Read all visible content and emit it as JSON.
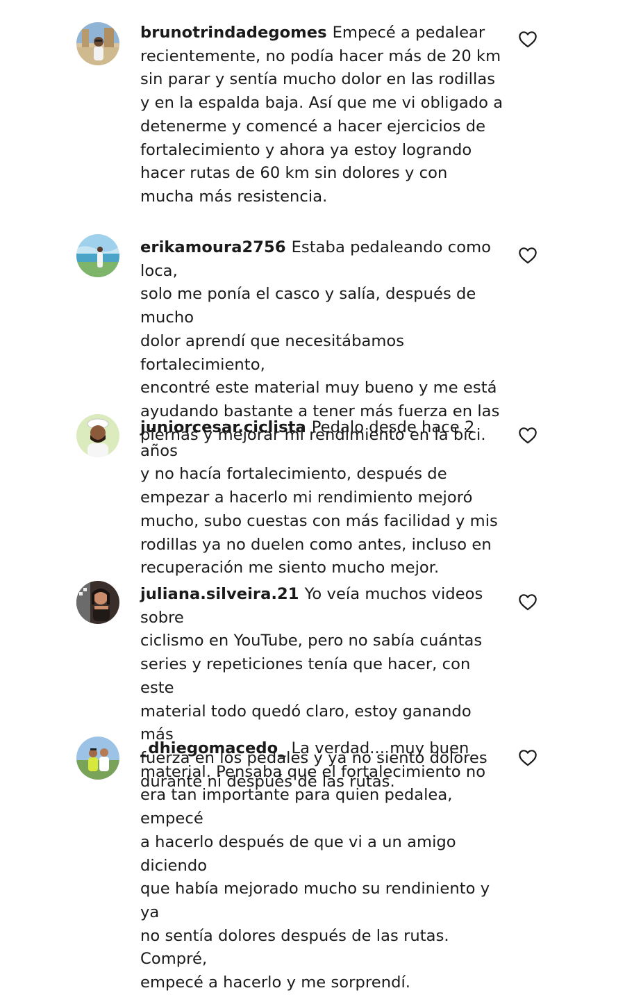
{
  "comments": [
    {
      "username": "brunotrindadegomes",
      "text": "Empecé a pedalear\nrecientemente, no podía hacer más de 20 km\nsin parar y sentía mucho dolor en las rodillas\ny en la espalda baja. Así que me vi obligado a\ndetenerme y comencé a hacer ejercicios de\nfortalecimiento y ahora ya estoy logrando\nhacer rutas de 60 km sin dolores y con\nmucha más resistencia.",
      "avatar": "avatar-desert-man"
    },
    {
      "username": "erikamoura2756",
      "text": "Estaba pedaleando como loca,\nsolo me ponía el casco y salía, después de mucho\ndolor aprendí que necesitábamos fortalecimiento,\nencontré este material muy bueno y me está\nayudando bastante a tener más fuerza en las\npiernas y mejorar mi rendimiento en la bici.",
      "avatar": "avatar-beach-woman"
    },
    {
      "username": "juniorcesar.ciclista",
      "text": "Pedalo desde hace 2 años\ny no hacía fortalecimiento, después de\nempezar a hacerlo mi rendimiento mejoró\nmucho, subo cuestas con más facilidad y mis\nrodillas ya no duelen como antes, incluso en\nrecuperación me siento mucho mejor.",
      "avatar": "avatar-man-cap"
    },
    {
      "username": "juliana.silveira.21",
      "text": "Yo veía muchos videos sobre\nciclismo en YouTube, pero no sabía cuántas\nseries y repeticiones tenía que hacer, con este\nmaterial todo quedó claro, estoy ganando más\nfuerza en los pedales y ya no siento dolores\ndurante ni después de las rutas.",
      "avatar": "avatar-woman-dark"
    },
    {
      "username": "_dhiegomacedo_",
      "text": "La verdad... muy buen\nmaterial. Pensaba que el fortalecimiento no\nera tan importante para quien pedalea, empecé\na hacerlo después de que vi a un amigo diciendo\nque había mejorado mucho su rendiniento y ya\nno sentía dolores después de las rutas. Compré,\nempecé a hacerlo y me sorprendí.",
      "avatar": "avatar-two-people"
    }
  ],
  "icons": {
    "like": "heart-outline-icon"
  },
  "colors": {
    "text": "#1a1a1a",
    "background": "#ffffff"
  }
}
